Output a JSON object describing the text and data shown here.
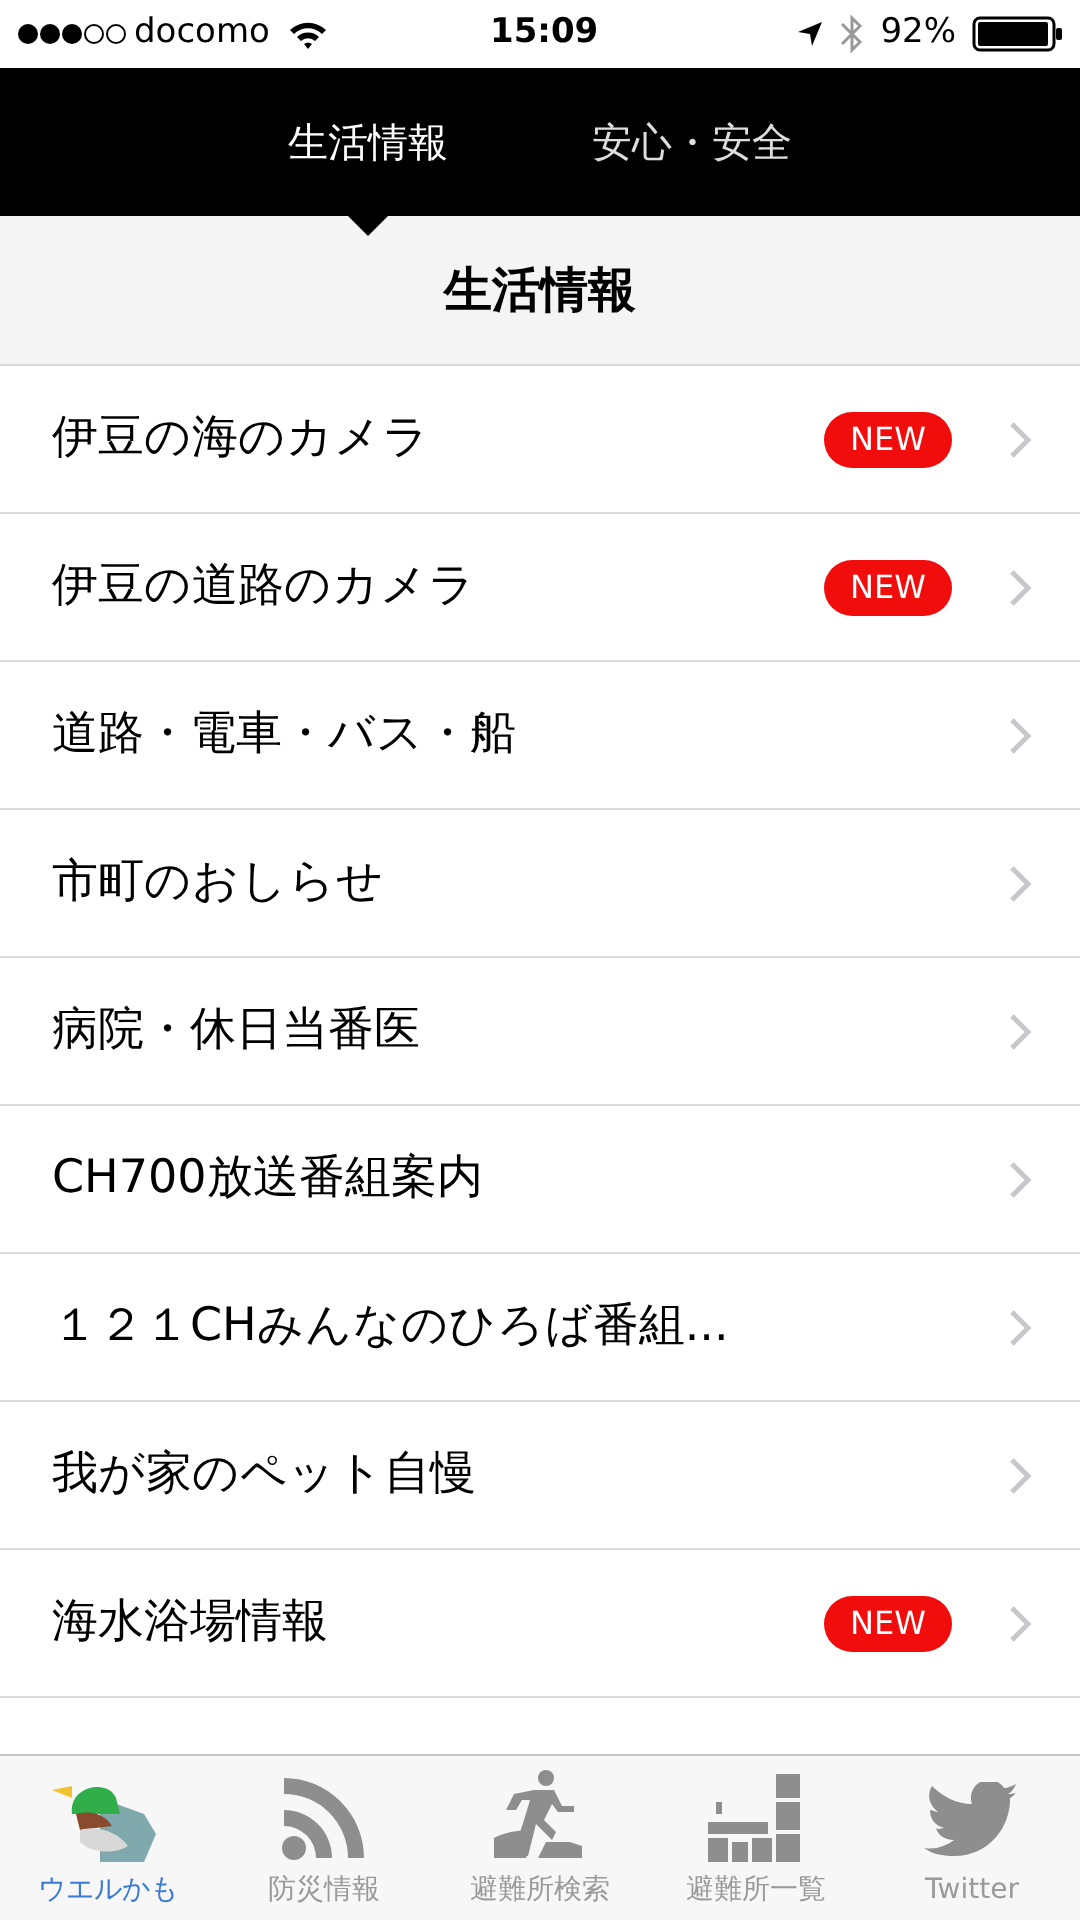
{
  "status_bar": {
    "carrier": "docomo",
    "time": "15:09",
    "battery": "92%"
  },
  "top_tabs": [
    {
      "label": "生活情報",
      "selected": true
    },
    {
      "label": "安心・安全",
      "selected": false
    }
  ],
  "header": {
    "title": "生活情報"
  },
  "list": [
    {
      "label": "伊豆の海のカメラ",
      "new": true,
      "badge": "NEW"
    },
    {
      "label": "伊豆の道路のカメラ",
      "new": true,
      "badge": "NEW"
    },
    {
      "label": "道路・電車・バス・船",
      "new": false
    },
    {
      "label": "市町のおしらせ",
      "new": false
    },
    {
      "label": "病院・休日当番医",
      "new": false
    },
    {
      "label": "CH700放送番組案内",
      "new": false
    },
    {
      "label": "１２１CHみんなのひろば番組...",
      "new": false
    },
    {
      "label": "我が家のペット自慢",
      "new": false
    },
    {
      "label": "海水浴場情報",
      "new": true,
      "badge": "NEW"
    }
  ],
  "tab_bar": [
    {
      "label": "ウエルかも",
      "kind": "duck",
      "selected": true
    },
    {
      "label": "防災情報",
      "kind": "rss",
      "selected": false
    },
    {
      "label": "避難所検索",
      "kind": "runner",
      "selected": false
    },
    {
      "label": "避難所一覧",
      "kind": "building",
      "selected": false
    },
    {
      "label": "Twitter",
      "kind": "bird",
      "selected": false
    }
  ]
}
